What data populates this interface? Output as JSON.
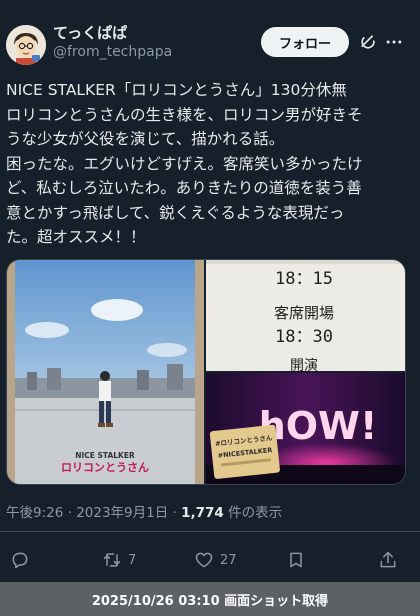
{
  "user": {
    "display_name": "てっくぱぱ",
    "handle": "@from_techpapa",
    "follow_label": "フォロー"
  },
  "tweet": {
    "lines": [
      "NICE STALKER「ロリコンとうさん」130分休無",
      "ロリコンとうさんの生き様を、ロリコン男が好きそ",
      "うな少女が父役を演じて、描かれる話。",
      "困ったな。エグいけどすげえ。客席笑い多かったけ",
      "ど、私むしろ泣いたわ。ありきたりの道徳を装う善",
      "意とかすっ飛ばして、鋭くえぐるような表現だっ",
      "た。超オススメ！！"
    ]
  },
  "media": {
    "poster_company": "NICE STALKER",
    "poster_title": "ロリコンとうさん",
    "sign_time1": "18：15",
    "sign_label": "客席開場",
    "sign_time2": "18：30",
    "sign_cut_top": "開演",
    "stage_letters": "hOW!",
    "ticket_line1": "#ロリコンとうさん",
    "ticket_line2": "#NICESTALKER"
  },
  "meta": {
    "timestamp": "午後9:26 · 2023年9月1日 · ",
    "views_count": "1,774",
    "views_suffix": " 件の表示"
  },
  "actions": {
    "reply_count": "",
    "retweet_count": "7",
    "like_count": "27"
  },
  "icons": {
    "reply": "reply-icon",
    "retweet": "retweet-icon",
    "like": "heart-icon",
    "bookmark": "bookmark-icon",
    "share": "share-icon",
    "grok": "grok-icon",
    "more": "more-icon"
  },
  "colors": {
    "background": "#15202b",
    "text": "#e7e9ea",
    "secondary_text": "#8b98a5",
    "footer_bg": "#5c6166"
  },
  "footer": {
    "capture_text": "2025/10/26 03:10 画面ショット取得"
  }
}
